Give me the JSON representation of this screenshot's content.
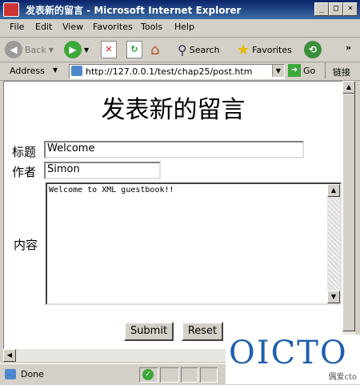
{
  "window": {
    "title": "发表新的留言 - Microsoft Internet Explorer"
  },
  "menu": [
    "File",
    "Edit",
    "View",
    "Favorites",
    "Tools",
    "Help"
  ],
  "toolbar": {
    "back": "Back",
    "search": "Search",
    "favorites": "Favorites"
  },
  "address": {
    "label": "Address",
    "url": "http://127.0.0.1/test/chap25/post.htm",
    "go": "Go",
    "links": "链接"
  },
  "page": {
    "heading": "发表新的留言",
    "title_label": "标题",
    "title_value": "Welcome",
    "author_label": "作者",
    "author_value": "Simon",
    "content_label": "内容",
    "content_value": "Welcome to XML guestbook!!",
    "submit": "Submit",
    "reset": "Reset"
  },
  "status": {
    "text": "Done"
  },
  "watermark": {
    "brand": "OICTO",
    "sub": "偶爱cto"
  },
  "colors": {
    "titlebar": "#0a246a",
    "brand": "#1f5fb0"
  }
}
